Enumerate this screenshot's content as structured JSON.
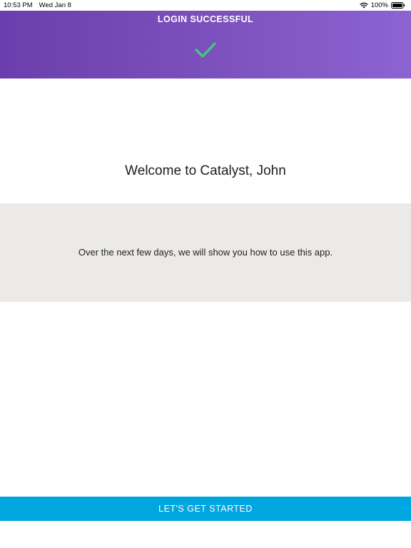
{
  "status_bar": {
    "time": "10:53 PM",
    "date": "Wed Jan 8",
    "battery": "100%",
    "icons": [
      "wifi-icon",
      "battery-icon"
    ]
  },
  "header": {
    "title": "LOGIN SUCCESSFUL",
    "icon": "check-icon",
    "check_color": "#3dcf7a"
  },
  "main": {
    "welcome": "Welcome to Catalyst, John",
    "info": "Over the next few days, we will show you how to use this app."
  },
  "cta": {
    "label": "LET'S GET STARTED",
    "color": "#00a6df"
  }
}
